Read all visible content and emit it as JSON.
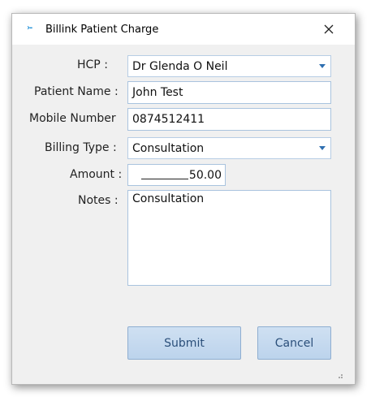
{
  "window": {
    "title": "Billink Patient Charge",
    "icon": "billink-arrow-icon",
    "app_icon_glyph": "›-"
  },
  "form": {
    "hcp_label": "HCP :",
    "hcp_value": "Dr Glenda  O Neil",
    "patient_name_label": "Patient Name :",
    "patient_name_value": "John Test",
    "mobile_label": "Mobile Number",
    "mobile_value": "0874512411",
    "billing_type_label": "Billing Type :",
    "billing_type_value": "Consultation",
    "amount_label": "Amount :",
    "amount_value": "50.00",
    "notes_label": "Notes :",
    "notes_value": "Consultation"
  },
  "buttons": {
    "submit_label": "Submit",
    "cancel_label": "Cancel"
  },
  "colors": {
    "accent": "#1e90d8",
    "field_border": "#a9c3de",
    "button_bg": "#c7dbef",
    "button_text": "#2b4f7a"
  }
}
